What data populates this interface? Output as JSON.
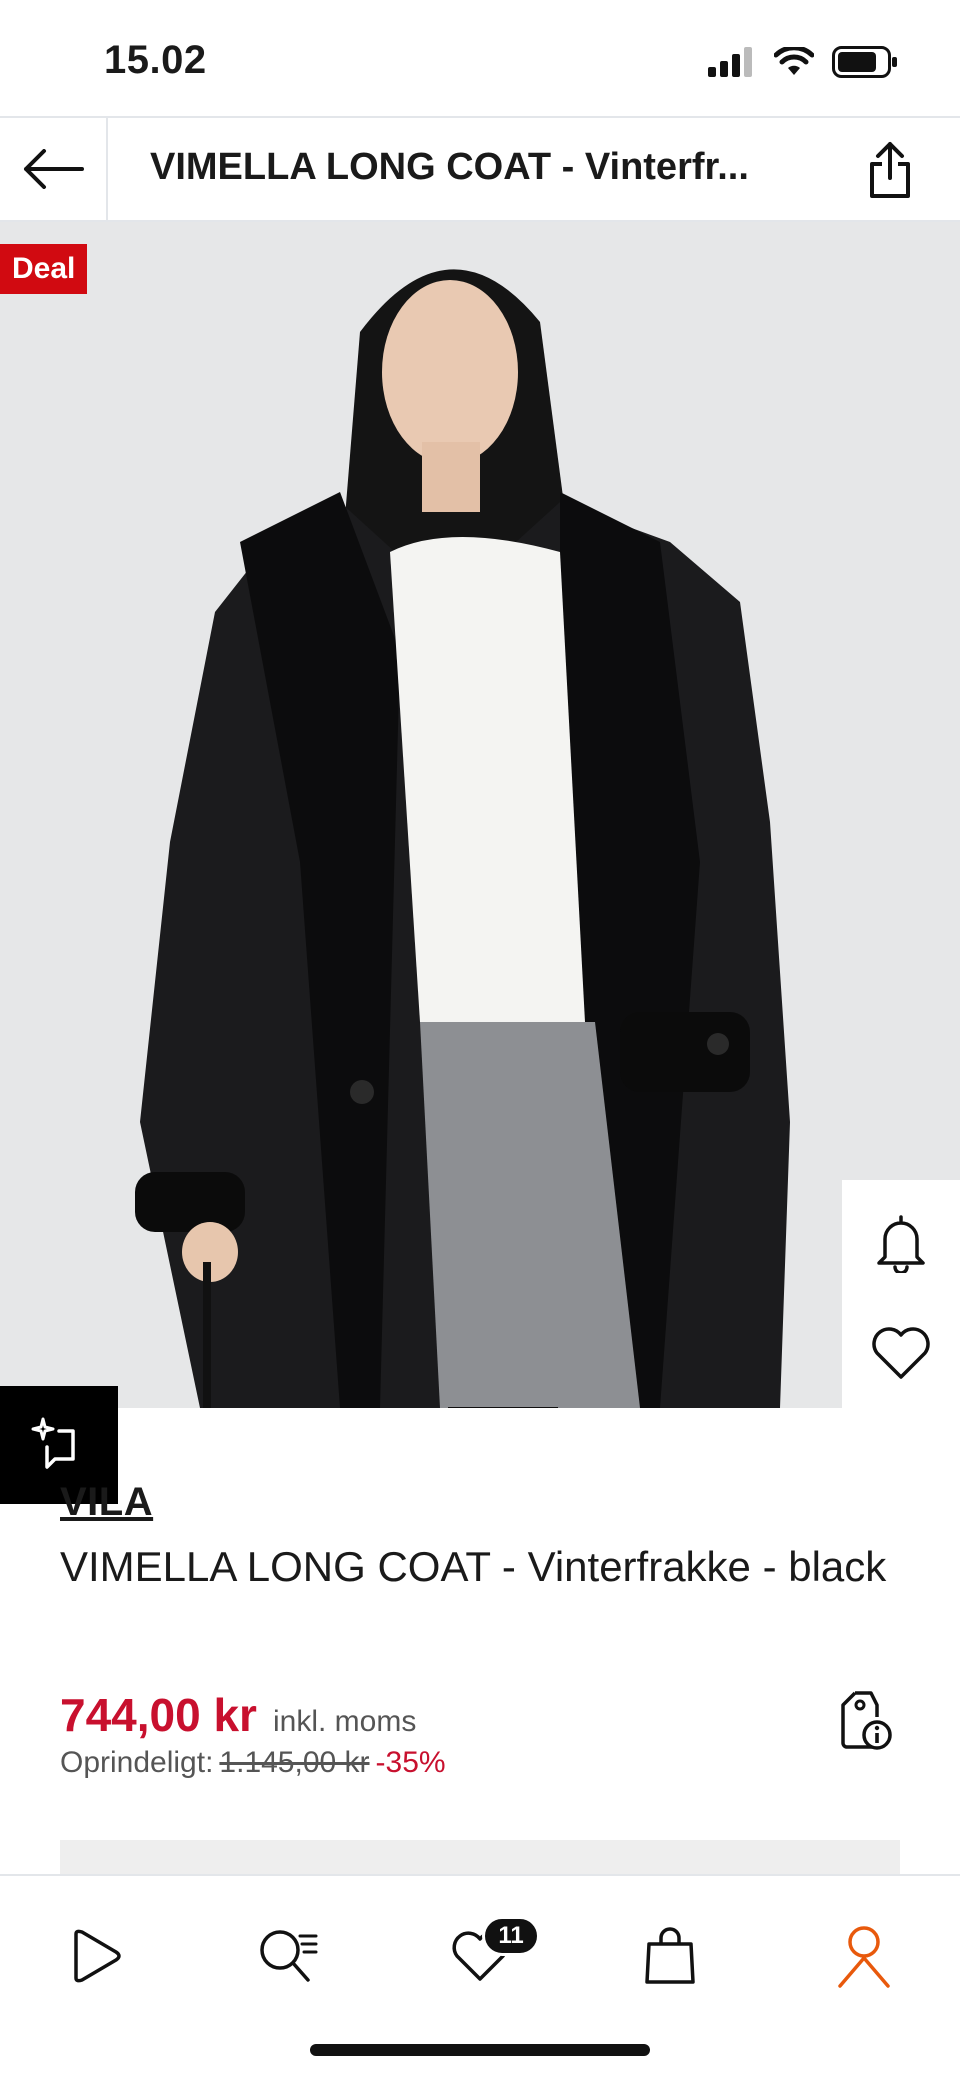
{
  "status_bar": {
    "time": "15.02"
  },
  "header": {
    "title": "VIMELLA LONG COAT - Vinterfr..."
  },
  "image": {
    "deal_label": "Deal"
  },
  "product": {
    "brand": "VILA",
    "name": "VIMELLA LONG COAT - Vinterfrakke - black",
    "price": "744,00 kr",
    "vat_note": "inkl. moms",
    "original_label": "Oprindeligt:",
    "original_price": "1.145,00 kr",
    "discount": "-35%"
  },
  "bottom_nav": {
    "wishlist_count": "11",
    "active_color": "#e8590c"
  },
  "colors": {
    "accent": "#c8102e",
    "deal": "#d10a11"
  }
}
